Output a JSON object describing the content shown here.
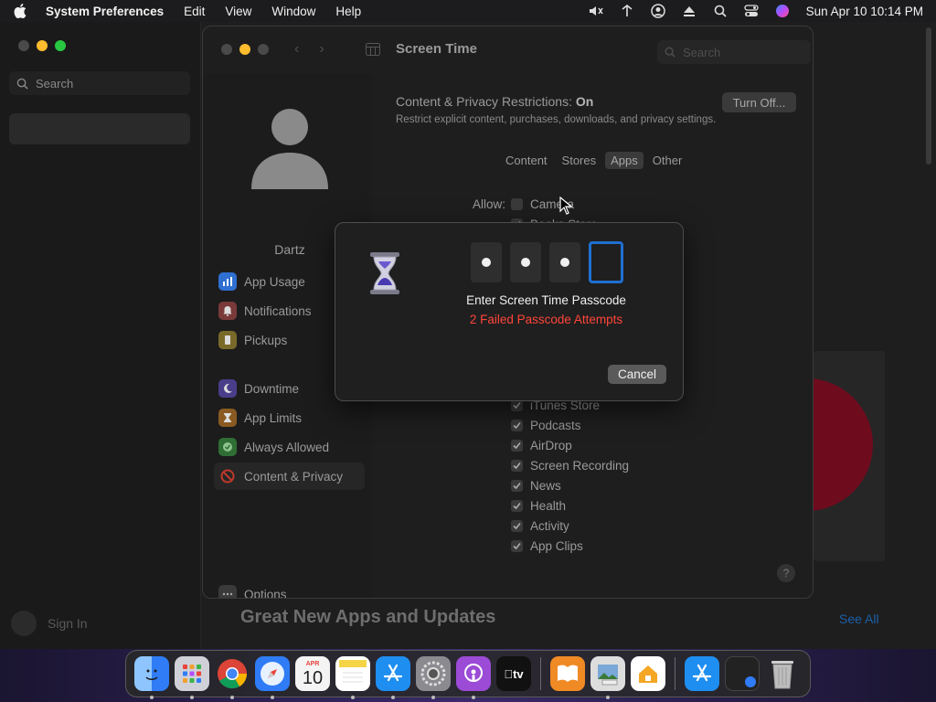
{
  "menubar": {
    "app_name": "System Preferences",
    "items": [
      "Edit",
      "View",
      "Window",
      "Help"
    ],
    "datetime": "Sun Apr 10  10:14 PM"
  },
  "background_window": {
    "search_placeholder": "Search",
    "sign_in": "Sign In",
    "heading": "Great New Apps and Updates",
    "see_all": "See All"
  },
  "screen_time": {
    "title": "Screen Time",
    "search_placeholder": "Search",
    "user_name": "Dartz",
    "nav": [
      {
        "label": "App Usage",
        "icon": "chart-icon",
        "color": "#2f7cf6"
      },
      {
        "label": "Notifications",
        "icon": "bell-icon",
        "color": "#e8453c"
      },
      {
        "label": "Pickups",
        "icon": "pickup-icon",
        "color": "#e8b43c"
      },
      {
        "label": "Downtime",
        "icon": "moon-icon",
        "color": "#6a5acd"
      },
      {
        "label": "App Limits",
        "icon": "hourglass-icon",
        "color": "#f09a35"
      },
      {
        "label": "Always Allowed",
        "icon": "check-shield-icon",
        "color": "#3cb34a"
      },
      {
        "label": "Content & Privacy",
        "icon": "no-entry-icon",
        "color": "#e8453c"
      }
    ],
    "options_label": "Options",
    "restrictions_label": "Content & Privacy Restrictions:",
    "restrictions_state": "On",
    "restrictions_desc": "Restrict explicit content, purchases, downloads, and privacy settings.",
    "turn_off_button": "Turn Off...",
    "tabs": [
      "Content",
      "Stores",
      "Apps",
      "Other"
    ],
    "selected_tab": "Apps",
    "allow_label": "Allow:",
    "allow_items_top": [
      {
        "label": "Camera",
        "checked": false
      },
      {
        "label": "Books Store",
        "checked": true
      }
    ],
    "allow_items_bottom": [
      {
        "label": "iTunes Store",
        "checked": true
      },
      {
        "label": "Podcasts",
        "checked": true
      },
      {
        "label": "AirDrop",
        "checked": true
      },
      {
        "label": "Screen Recording",
        "checked": true
      },
      {
        "label": "News",
        "checked": true
      },
      {
        "label": "Health",
        "checked": true
      },
      {
        "label": "Activity",
        "checked": true
      },
      {
        "label": "App Clips",
        "checked": true
      }
    ],
    "help": "?"
  },
  "dialog": {
    "digits_entered": 3,
    "digits_total": 4,
    "title": "Enter Screen Time Passcode",
    "error": "2 Failed Passcode Attempts",
    "error_color": "#ff453a",
    "cancel_button": "Cancel"
  },
  "dock": {
    "apps": [
      "Finder",
      "Launchpad",
      "Chrome",
      "Safari",
      "Calendar",
      "Notes",
      "App Store",
      "System Preferences",
      "Podcasts",
      "TV",
      "Books",
      "Preview",
      "Home",
      "Downloads",
      "Screenshot",
      "Trash"
    ],
    "calendar_month": "APR",
    "calendar_day": "10",
    "tv_label": "tv"
  }
}
